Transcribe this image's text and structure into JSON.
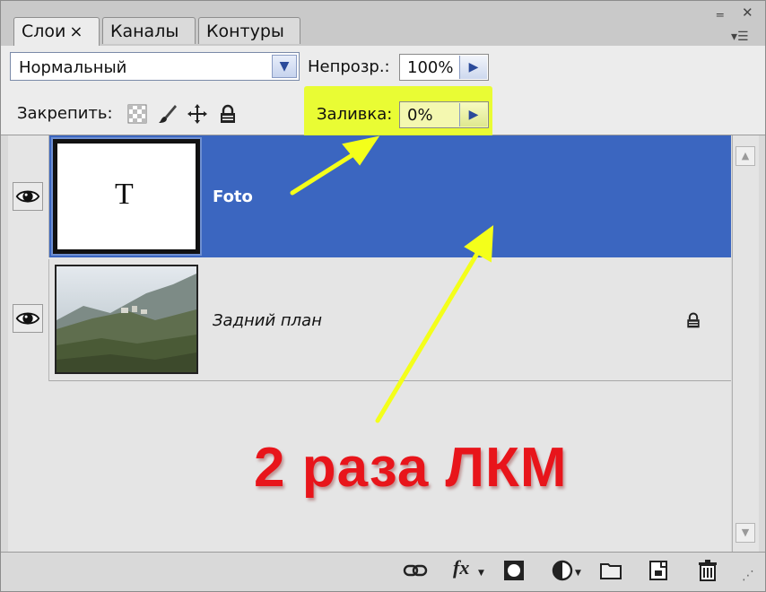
{
  "tabs": [
    {
      "label": "Слои",
      "close": "×",
      "active": true
    },
    {
      "label": "Каналы",
      "active": false
    },
    {
      "label": "Контуры",
      "active": false
    }
  ],
  "window_controls": {
    "minimize": "‗",
    "close": "✕",
    "menu": "▾☰"
  },
  "blend_mode": {
    "value": "Нормальный"
  },
  "opacity": {
    "label": "Непрозр.:",
    "value": "100%"
  },
  "lock": {
    "label": "Закрепить:"
  },
  "fill": {
    "label": "Заливка:",
    "value": "0%"
  },
  "layers": [
    {
      "name": "Foto",
      "thumb_text": "T",
      "selected": true,
      "visible": true
    },
    {
      "name": "Задний план",
      "selected": false,
      "visible": true,
      "locked": true
    }
  ],
  "annotation": {
    "text": "2 раза ЛКМ"
  },
  "colors": {
    "selection": "#3b66c0",
    "highlight": "#e9ff14",
    "annotation_text": "#e8151b",
    "arrow": "#f4ff1a"
  },
  "icons": {
    "lock_transparent": "checker-icon",
    "lock_image": "brush-icon",
    "lock_position": "move-icon",
    "lock_all": "lock-icon",
    "bottom": [
      "link-icon",
      "fx-icon",
      "mask-icon",
      "adjustment-icon",
      "folder-icon",
      "new-layer-icon",
      "trash-icon"
    ]
  },
  "bottom_fx": "fx"
}
